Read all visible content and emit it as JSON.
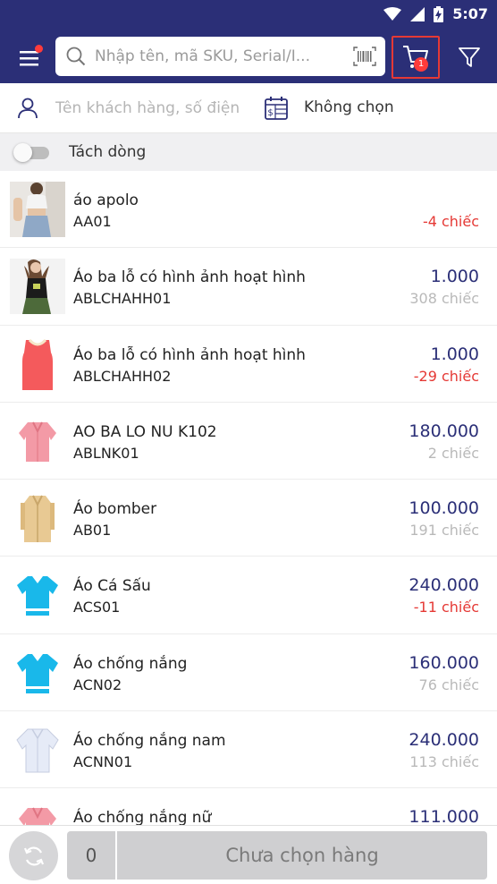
{
  "status_bar": {
    "time": "5:07",
    "icons": [
      "wifi-icon",
      "signal-icon",
      "battery-charging-icon"
    ]
  },
  "header": {
    "menu_icon": "hamburger-menu-icon",
    "search": {
      "placeholder": "Nhập tên, mã SKU, Serial/I...",
      "value": ""
    },
    "barcode_icon": "barcode-scan-icon",
    "cart": {
      "icon": "cart-icon",
      "badge": "1"
    },
    "filter_icon": "filter-icon"
  },
  "customer": {
    "placeholder": "Tên khách hàng, số điện thoại",
    "value": "",
    "pricelist_icon": "price-table-icon",
    "pricelist_label": "Không chọn"
  },
  "split_line": {
    "label": "Tách dòng",
    "enabled": false
  },
  "products": [
    {
      "name": "áo apolo",
      "sku": "AA01",
      "price": "",
      "stock": "-4 chiếc",
      "stock_negative": true,
      "image": "crop-top-photo"
    },
    {
      "name": "Áo ba lỗ có hình ảnh hoạt hình",
      "sku": "ABLCHAHH01",
      "price": "1.000",
      "stock": "308 chiếc",
      "stock_negative": false,
      "image": "tank-top-photo"
    },
    {
      "name": "Áo ba lỗ có hình ảnh hoạt hình",
      "sku": "ABLCHAHH02",
      "price": "1.000",
      "stock": "-29 chiếc",
      "stock_negative": true,
      "image": "red-tank-top"
    },
    {
      "name": "AO BA LO NU K102",
      "sku": "ABLNK01",
      "price": "180.000",
      "stock": "2 chiếc",
      "stock_negative": false,
      "image": "pink-blouse"
    },
    {
      "name": "Áo bomber",
      "sku": "AB01",
      "price": "100.000",
      "stock": "191 chiếc",
      "stock_negative": false,
      "image": "beige-coat"
    },
    {
      "name": "Áo Cá Sấu",
      "sku": "ACS01",
      "price": "240.000",
      "stock": "-11 chiếc",
      "stock_negative": true,
      "image": "blue-polo"
    },
    {
      "name": "Áo chống nắng",
      "sku": "ACN02",
      "price": "160.000",
      "stock": "76 chiếc",
      "stock_negative": false,
      "image": "blue-polo"
    },
    {
      "name": "Áo chống nắng nam",
      "sku": "ACNN01",
      "price": "240.000",
      "stock": "113 chiếc",
      "stock_negative": false,
      "image": "white-shirt"
    },
    {
      "name": "Áo chống nắng nữ",
      "sku": "",
      "price": "111.000",
      "stock": "",
      "stock_negative": false,
      "image": "pink-blouse"
    }
  ],
  "bottom_bar": {
    "refresh_icon": "refresh-icon",
    "quantity": "0",
    "checkout_label": "Chưa chọn hàng"
  },
  "colors": {
    "primary": "#2b2f77",
    "negative_stock": "#e53935",
    "muted_stock": "#b9b9b9",
    "badge": "#ff3b3b"
  }
}
